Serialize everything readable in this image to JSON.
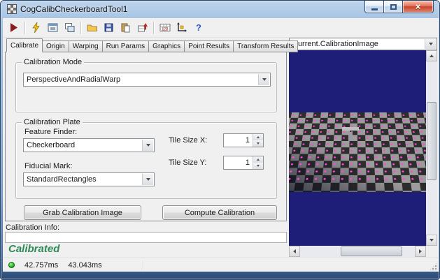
{
  "window": {
    "title": "CogCalibCheckerboardTool1",
    "close_glyph": "×"
  },
  "toolbar": {
    "buttons": [
      "run",
      "electric-run",
      "image-display",
      "float-window",
      "open",
      "save",
      "paste",
      "import",
      "results-table",
      "position",
      "help"
    ]
  },
  "tabs": [
    "Calibrate",
    "Origin",
    "Warping",
    "Run Params",
    "Graphics",
    "Point Results",
    "Transform Results"
  ],
  "left_panel": {
    "calibration_mode": {
      "label": "Calibration Mode",
      "value": "PerspectiveAndRadialWarp"
    },
    "calibration_plate": {
      "label": "Calibration Plate",
      "feature_finder": {
        "label": "Feature Finder:",
        "value": "Checkerboard"
      },
      "fiducial_mark": {
        "label": "Fiducial Mark:",
        "value": "StandardRectangles"
      },
      "tile_size_x": {
        "label": "Tile Size X:",
        "value": "1"
      },
      "tile_size_y": {
        "label": "Tile Size Y:",
        "value": "1"
      }
    },
    "buttons": {
      "grab": "Grab Calibration Image",
      "compute": "Compute Calibration"
    }
  },
  "calibration_info": {
    "label": "Calibration Info:",
    "value": "",
    "status": "Calibrated"
  },
  "status_bar": {
    "run_time": "42.757ms",
    "total_time": "43.043ms"
  },
  "right_panel": {
    "image_selector": "Current.CalibrationImage"
  },
  "icons": {
    "app-icon": "checkerboard-grid",
    "run-icon": "dark-red play triangle",
    "electric-run-icon": "yellow lightning bolt",
    "image-display-icon": "window with image",
    "float-window-icon": "two overlapping windows",
    "open-icon": "yellow folder",
    "save-icon": "blue floppy disk",
    "paste-icon": "clipboard with page",
    "import-icon": "grid with red up arrow",
    "results-table-icon": "table with 123",
    "position-icon": "xy axes crosshair",
    "help-icon": "blue question mark",
    "dropdown-arrow-icon": "css triangle down",
    "status-led-icon": "green circle"
  },
  "colors": {
    "image_background": "#1e1e78",
    "marker_pink": "#ff49d8",
    "status_green": "#2e8b57"
  }
}
